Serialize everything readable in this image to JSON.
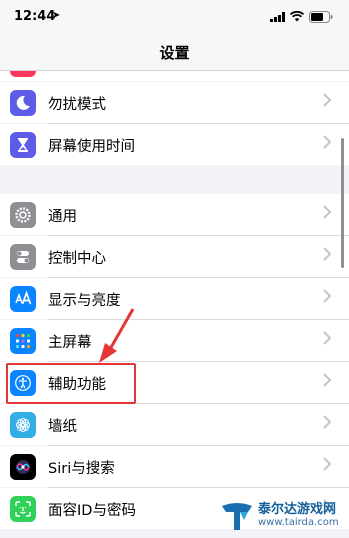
{
  "status_bar": {
    "time": "12:44",
    "location_glyph": "➤"
  },
  "nav": {
    "title": "设置"
  },
  "rows": [
    {
      "label": "勿扰模式",
      "icon": "moon-icon",
      "color": "#5e5ce6"
    },
    {
      "label": "屏幕使用时间",
      "icon": "hourglass-icon",
      "color": "#5e5ce6"
    },
    {
      "label": "通用",
      "icon": "gear-icon",
      "color": "#8e8e93"
    },
    {
      "label": "控制中心",
      "icon": "toggles-icon",
      "color": "#8e8e93"
    },
    {
      "label": "显示与亮度",
      "icon": "text-size-icon",
      "color": "#0a84ff"
    },
    {
      "label": "主屏幕",
      "icon": "home-grid-icon",
      "color": "#0a84ff"
    },
    {
      "label": "辅助功能",
      "icon": "accessibility-icon",
      "color": "#0a84ff"
    },
    {
      "label": "墙纸",
      "icon": "flower-icon",
      "color": "#32ade6"
    },
    {
      "label": "Siri与搜索",
      "icon": "siri-icon",
      "color": "#000000"
    },
    {
      "label": "面容ID与密码",
      "icon": "face-id-icon",
      "color": "#30d158"
    }
  ],
  "annotation": {
    "highlight_color": "#e43636"
  },
  "watermark": {
    "name": "泰尔达游戏网",
    "url": "www.tairda.com"
  }
}
